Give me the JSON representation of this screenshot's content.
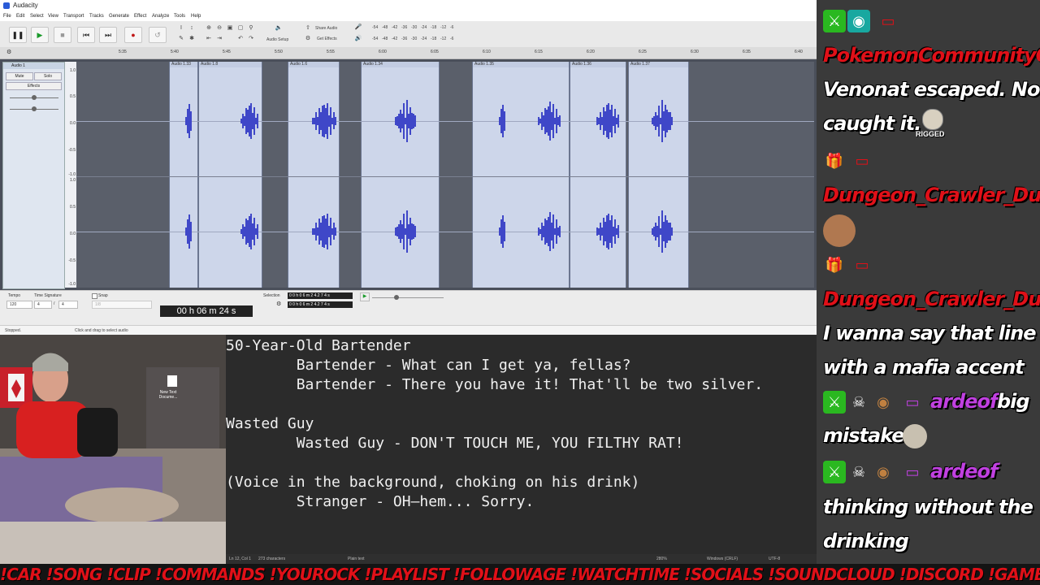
{
  "window": {
    "title": "Audacity"
  },
  "menu": [
    "File",
    "Edit",
    "Select",
    "View",
    "Transport",
    "Tracks",
    "Generate",
    "Effect",
    "Analyze",
    "Tools",
    "Help"
  ],
  "toolbar": {
    "audio_setup": "Audio Setup",
    "share_audio": "Share Audio",
    "get_effects": "Get Effects",
    "meter_ticks": [
      "-54",
      "-48",
      "-42",
      "-36",
      "-30",
      "-24",
      "-18",
      "-12",
      "-6"
    ]
  },
  "ruler": {
    "ticks": [
      "5:35",
      "5:40",
      "5:45",
      "5:50",
      "5:55",
      "6:00",
      "6:05",
      "6:10",
      "6:15",
      "6:20",
      "6:25",
      "6:30",
      "6:35",
      "6:40"
    ]
  },
  "track": {
    "name": "Audio 1",
    "mute": "Mute",
    "solo": "Solo",
    "effects": "Effects",
    "scale": [
      "1.0",
      "0.5",
      "0.0",
      "-0.5",
      "-1.0",
      "1.0",
      "0.5",
      "0.0",
      "-0.5",
      "-1.0"
    ]
  },
  "clips": [
    "Audio 1.33",
    "Audio 1.8",
    "Audio 1.6",
    "Audio 1.34",
    "Audio 1.35",
    "Audio 1.36",
    "Audio 1.37"
  ],
  "selection_toolbar": {
    "tempo_label": "Tempo",
    "tempo_value": "120",
    "time_sig_label": "Time Signature",
    "time_sig_num": "4",
    "time_sig_den": "4",
    "snap_label": "Snap",
    "snap_value": "1/8",
    "time": "00 h 06 m 24 s",
    "selection_label": "Selection",
    "selection_start": "0 0 h 0 6 m 2 4.2 7 4 s",
    "selection_end": "0 0 h 0 6 m 2 4.2 7 4 s"
  },
  "status": {
    "state": "Stopped.",
    "hint": "Click and drag to select audio"
  },
  "desktop_icon": "New Text Docume...",
  "notepad": {
    "lines": [
      "50-Year-Old Bartender",
      "        Bartender - What can I get ya, fellas?",
      "        Bartender - There you have it! That'll be two silver.",
      "",
      "Wasted Guy",
      "        Wasted Guy - DON'T TOUCH ME, YOU FILTHY RAT!",
      "",
      "(Voice in the background, choking on his drink)",
      "        Stranger - OH—hem... Sorry."
    ],
    "status": {
      "position": "Ln 12, Col 1",
      "chars": "273 characters",
      "format": "Plain text",
      "zoom": "280%",
      "eol": "Windows (CRLF)",
      "encoding": "UTF-8"
    }
  },
  "chat": {
    "user1": "PokemonCommunityGar",
    "msg1a": "Venonat escaped. No one",
    "msg1b": "caught it.",
    "emote1": "RIGGED",
    "user2": "Dungeon_Crawler_Dud",
    "user3": "Dungeon_Crawler_Dud",
    "msg3a": "I wanna say that line",
    "msg3b": "with a mafia accent",
    "user4": "ardeof",
    "msg4a": "big",
    "msg4b": "mistake",
    "user5": "ardeof",
    "msg5a": "thinking without the",
    "msg5b": "drinking"
  },
  "ticker": "!CAR !SONG !CLIP !COMMANDS !YOUROCK !PLAYLIST !FOLLOWAGE !WATCHTIME !SOCIALS !SOUNDCLOUD !DISCORD !GAMBLE !ROULETTE"
}
